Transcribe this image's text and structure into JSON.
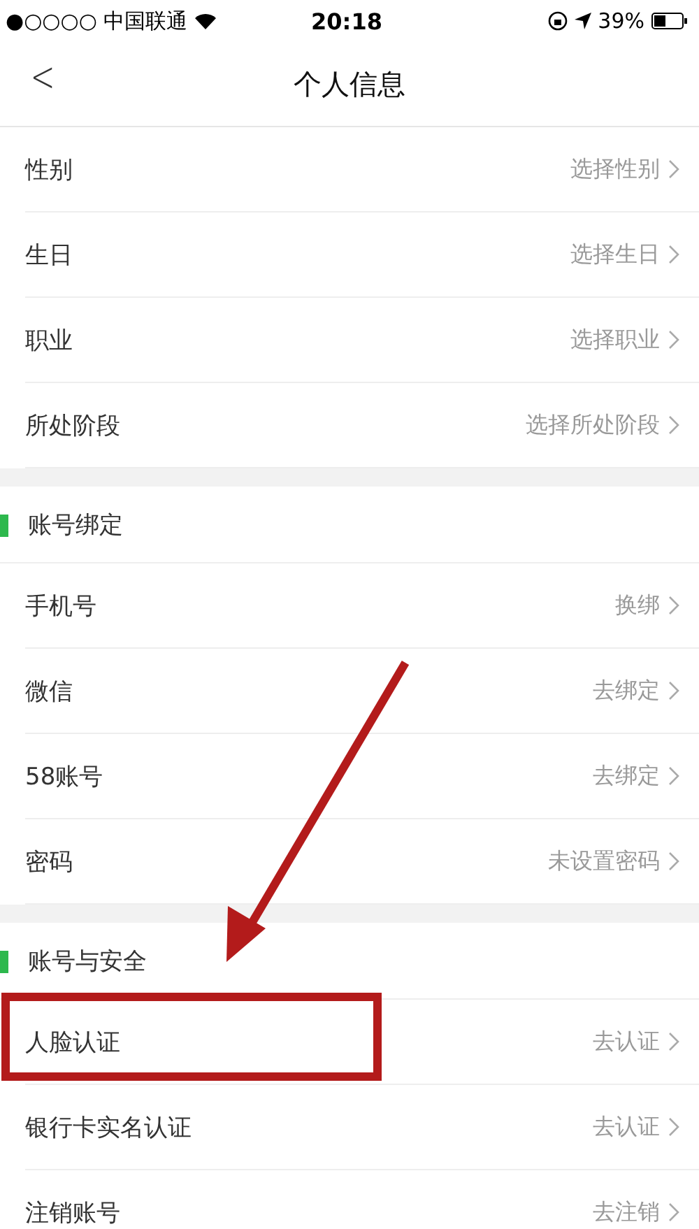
{
  "status_bar": {
    "carrier": "●○○○○ 中国联通",
    "time": "20:18",
    "battery": "39%"
  },
  "nav": {
    "back": "<",
    "title": "个人信息"
  },
  "sections": [
    {
      "items": [
        {
          "label": "性别",
          "value": "选择性别"
        },
        {
          "label": "生日",
          "value": "选择生日"
        },
        {
          "label": "职业",
          "value": "选择职业"
        },
        {
          "label": "所处阶段",
          "value": "选择所处阶段"
        }
      ]
    },
    {
      "header": "账号绑定",
      "items": [
        {
          "label": "手机号",
          "value": "换绑"
        },
        {
          "label": "微信",
          "value": "去绑定"
        },
        {
          "label": "58账号",
          "value": "去绑定"
        },
        {
          "label": "密码",
          "value": "未设置密码"
        }
      ]
    },
    {
      "header": "账号与安全",
      "items": [
        {
          "label": "人脸认证",
          "value": "去认证"
        },
        {
          "label": "银行卡实名认证",
          "value": "去认证"
        },
        {
          "label": "注销账号",
          "value": "去注销"
        }
      ]
    }
  ]
}
